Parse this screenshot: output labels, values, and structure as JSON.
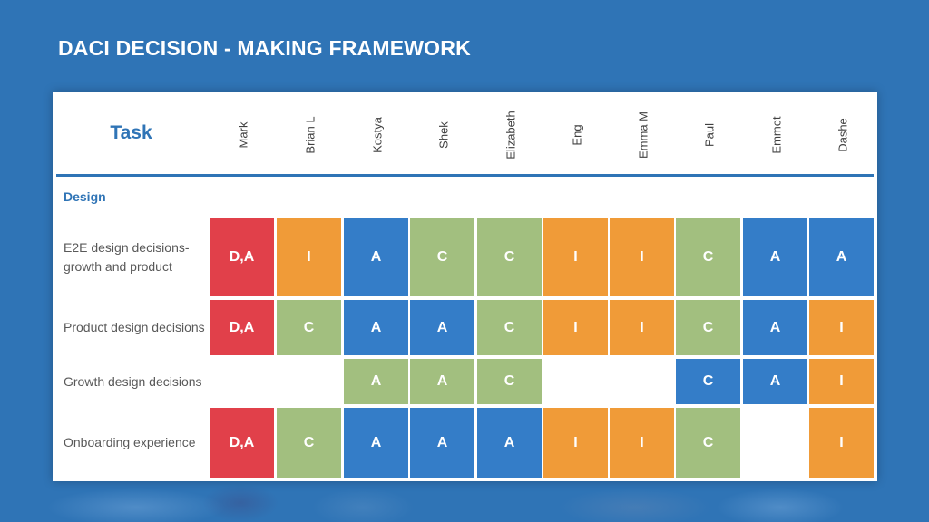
{
  "title": "DACI DECISION - MAKING FRAMEWORK",
  "table": {
    "task_header": "Task",
    "people": [
      "Mark",
      "Brian L",
      "Kostya",
      "Shek",
      "Elizabeth",
      "Eng",
      "Emma M",
      "Paul",
      "Emmet",
      "Dashe"
    ],
    "section": "Design",
    "rows": [
      {
        "task": "E2E design decisions- growth and product",
        "cells": [
          {
            "label": "D,A",
            "color": "red"
          },
          {
            "label": "I",
            "color": "orange"
          },
          {
            "label": "A",
            "color": "blue"
          },
          {
            "label": "C",
            "color": "green"
          },
          {
            "label": "C",
            "color": "green"
          },
          {
            "label": "I",
            "color": "orange"
          },
          {
            "label": "I",
            "color": "orange"
          },
          {
            "label": "C",
            "color": "green"
          },
          {
            "label": "A",
            "color": "blue"
          },
          {
            "label": "A",
            "color": "blue"
          }
        ]
      },
      {
        "task": "Product design decisions",
        "cells": [
          {
            "label": "D,A",
            "color": "red"
          },
          {
            "label": "C",
            "color": "green"
          },
          {
            "label": "A",
            "color": "blue"
          },
          {
            "label": "A",
            "color": "blue"
          },
          {
            "label": "C",
            "color": "green"
          },
          {
            "label": "I",
            "color": "orange"
          },
          {
            "label": "I",
            "color": "orange"
          },
          {
            "label": "C",
            "color": "green"
          },
          {
            "label": "A",
            "color": "blue"
          },
          {
            "label": "I",
            "color": "orange"
          }
        ]
      },
      {
        "task": "Growth design decisions",
        "cells": [
          {
            "label": "",
            "color": "none"
          },
          {
            "label": "",
            "color": "none"
          },
          {
            "label": "A",
            "color": "green"
          },
          {
            "label": "A",
            "color": "green"
          },
          {
            "label": "C",
            "color": "green"
          },
          {
            "label": "",
            "color": "none"
          },
          {
            "label": "",
            "color": "none"
          },
          {
            "label": "C",
            "color": "blue"
          },
          {
            "label": "A",
            "color": "blue"
          },
          {
            "label": "I",
            "color": "orange"
          }
        ]
      },
      {
        "task": "Onboarding experience",
        "cells": [
          {
            "label": "D,A",
            "color": "red"
          },
          {
            "label": "C",
            "color": "green"
          },
          {
            "label": "A",
            "color": "blue"
          },
          {
            "label": "A",
            "color": "blue"
          },
          {
            "label": "A",
            "color": "blue"
          },
          {
            "label": "I",
            "color": "orange"
          },
          {
            "label": "I",
            "color": "orange"
          },
          {
            "label": "C",
            "color": "green"
          },
          {
            "label": "",
            "color": "none"
          },
          {
            "label": "I",
            "color": "orange"
          }
        ]
      }
    ]
  },
  "colors": {
    "red": "#e1404a",
    "orange": "#f09b38",
    "blue": "#347dc8",
    "green": "#a2bf7f",
    "accent": "#2f74b6",
    "background": "#2f74b6"
  }
}
